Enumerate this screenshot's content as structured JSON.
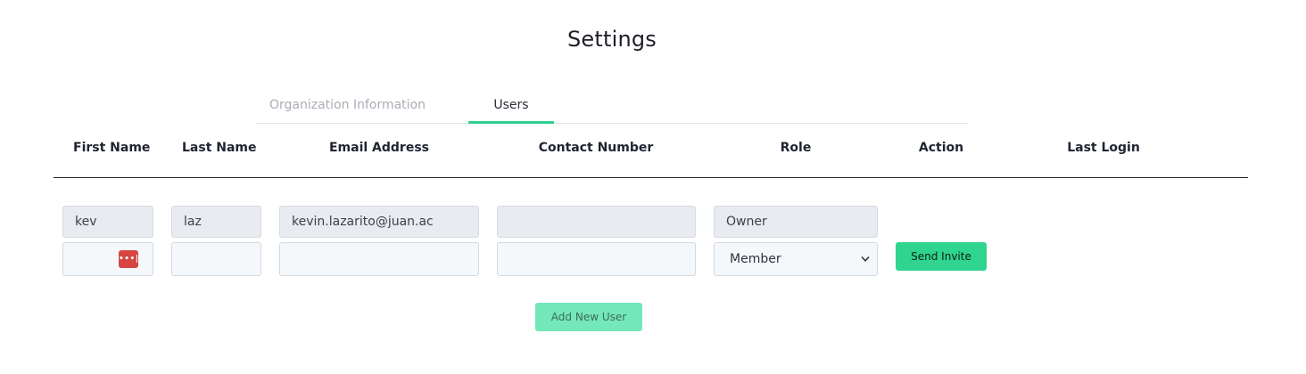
{
  "page": {
    "title": "Settings"
  },
  "tabs": [
    {
      "label": "Organization Information",
      "active": false
    },
    {
      "label": "Users",
      "active": true
    }
  ],
  "table": {
    "columns": [
      "First Name",
      "Last Name",
      "Email Address",
      "Contact Number",
      "Role",
      "Action",
      "Last Login"
    ],
    "rows": [
      {
        "first_name": "kev",
        "last_name": "laz",
        "email": "kevin.lazarito@juan.ac",
        "contact_number": "",
        "role": "Owner"
      }
    ],
    "new_row": {
      "first_name": "",
      "last_name": "",
      "email": "",
      "contact_number": "",
      "role_selected": "Member",
      "action_label": "Send Invite",
      "password_manager_badge": "•••|"
    }
  },
  "add_user_label": "Add New User",
  "colors": {
    "accent": "#2fcf8f",
    "send_button": "#2fd48e",
    "add_button": "#74e8b8",
    "password_badge": "#d64541",
    "filled_input": "#e8ebef",
    "empty_input": "#f5f8fb"
  },
  "icons": {
    "select_chevron": "chevron-down-icon",
    "password_manager": "password-manager-icon"
  }
}
